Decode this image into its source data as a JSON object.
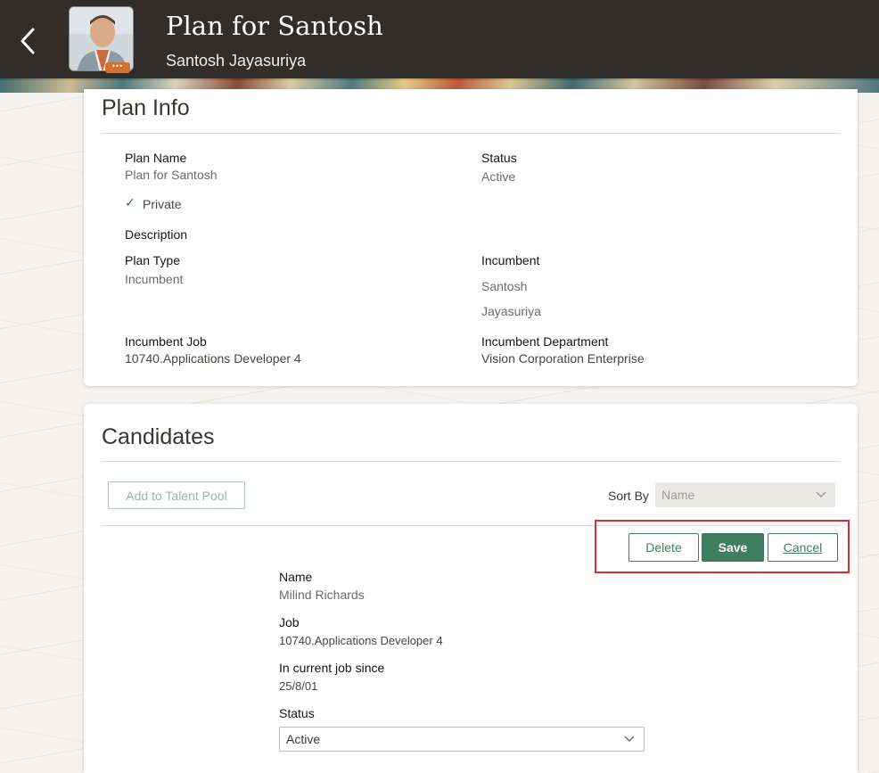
{
  "header": {
    "title": "Plan for Santosh",
    "subtitle": "Santosh Jayasuriya",
    "avatar_more": "•••",
    "back_icon": "chevron-left-icon"
  },
  "plan_info": {
    "heading": "Plan Info",
    "plan_name_label": "Plan Name",
    "plan_name_value": "Plan for Santosh",
    "status_label": "Status",
    "status_value": "Active",
    "private_check": "✓",
    "private_label": "Private",
    "description_label": "Description",
    "plan_type_label": "Plan Type",
    "plan_type_value": "Incumbent",
    "incumbent_label": "Incumbent",
    "incumbent_first": "Santosh",
    "incumbent_last": "Jayasuriya",
    "incumbent_job_label": "Incumbent Job",
    "incumbent_job_value": "10740.Applications Developer 4",
    "incumbent_dept_label": "Incumbent Department",
    "incumbent_dept_value": "Vision Corporation Enterprise"
  },
  "candidates": {
    "heading": "Candidates",
    "add_to_talent_pool": "Add to Talent Pool",
    "sort_by_label": "Sort By",
    "sort_by_value": "Name",
    "delete_label": "Delete",
    "save_label": "Save",
    "cancel_label": "Cancel",
    "name_label": "Name",
    "name_value": "Milind Richards",
    "job_label": "Job",
    "job_value": "10740.Applications Developer 4",
    "since_label": "In current job since",
    "since_value": "25/8/01",
    "status_label": "Status",
    "status_value": "Active"
  },
  "colors": {
    "header_bg": "#312d2a",
    "accent_green": "#3f7f61",
    "highlight_red": "#e1262c"
  }
}
